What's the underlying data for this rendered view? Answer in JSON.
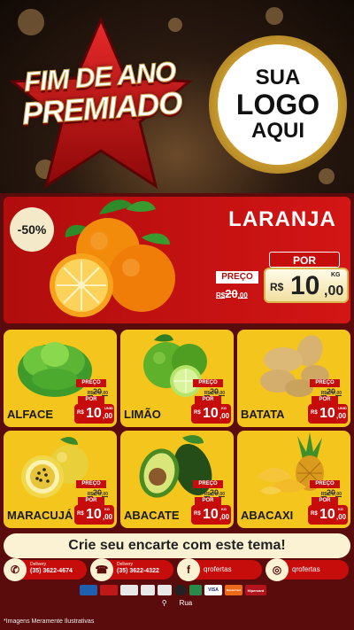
{
  "header": {
    "title_line1": "FIM DE ANO",
    "title_line2": "PREMIADO",
    "logo_line1": "SUA",
    "logo_line2": "LOGO",
    "logo_line3": "AQUI"
  },
  "hero": {
    "badge": "-50%",
    "name": "LARANJA",
    "preco_label": "PREÇO",
    "old_prefix": "R$",
    "old_int": "20",
    "old_dec": ",00",
    "por_label": "POR",
    "currency": "R$",
    "price_int": "10",
    "price_dec": ",00",
    "unit": "KG"
  },
  "products": [
    {
      "name": "ALFACE",
      "preco_label": "PREÇO",
      "old_prefix": "R$",
      "old_int": "20",
      "old_dec": ",00",
      "por_label": "POR",
      "currency": "R$",
      "price_int": "10",
      "price_dec": ",00",
      "unit": "UNID"
    },
    {
      "name": "LIMÃO",
      "preco_label": "PREÇO",
      "old_prefix": "R$",
      "old_int": "20",
      "old_dec": ",00",
      "por_label": "POR",
      "currency": "R$",
      "price_int": "10",
      "price_dec": ",00",
      "unit": "KG"
    },
    {
      "name": "BATATA",
      "preco_label": "PREÇO",
      "old_prefix": "R$",
      "old_int": "20",
      "old_dec": ",00",
      "por_label": "POR",
      "currency": "R$",
      "price_int": "10",
      "price_dec": ",00",
      "unit": "UNID"
    },
    {
      "name": "MARACUJÁ",
      "preco_label": "PREÇO",
      "old_prefix": "R$",
      "old_int": "20",
      "old_dec": ",00",
      "por_label": "POR",
      "currency": "R$",
      "price_int": "10",
      "price_dec": ",00",
      "unit": "KG"
    },
    {
      "name": "ABACATE",
      "preco_label": "PREÇO",
      "old_prefix": "R$",
      "old_int": "20",
      "old_dec": ",00",
      "por_label": "POR",
      "currency": "R$",
      "price_int": "10",
      "price_dec": ",00",
      "unit": "KG"
    },
    {
      "name": "ABACAXI",
      "preco_label": "PREÇO",
      "old_prefix": "R$",
      "old_int": "20",
      "old_dec": ",00",
      "por_label": "POR",
      "currency": "R$",
      "price_int": "10",
      "price_dec": ",00",
      "unit": "KG"
    }
  ],
  "footer": {
    "cta": "Crie seu encarte com este tema!",
    "whatsapp_label": "Delivery",
    "whatsapp_number": "(35) 3622-4674",
    "phone_label": "Delivery",
    "phone_number": "(35) 3622-4322",
    "facebook": "qrofertas",
    "instagram": "qrofertas",
    "payments": [
      "VISA",
      "MasterCard",
      "Hipercard"
    ],
    "address": "Rua",
    "disclaimer": "*Imagens Meramente Ilustrativas"
  },
  "colors": {
    "accent_red": "#c70c0c",
    "card_yellow": "#f4c51c",
    "background": "#5a0c0c",
    "cream": "#fbf2d3"
  },
  "icons": [
    "star-icon",
    "whatsapp-icon",
    "phone-icon",
    "facebook-icon",
    "instagram-icon",
    "location-pin-icon"
  ]
}
